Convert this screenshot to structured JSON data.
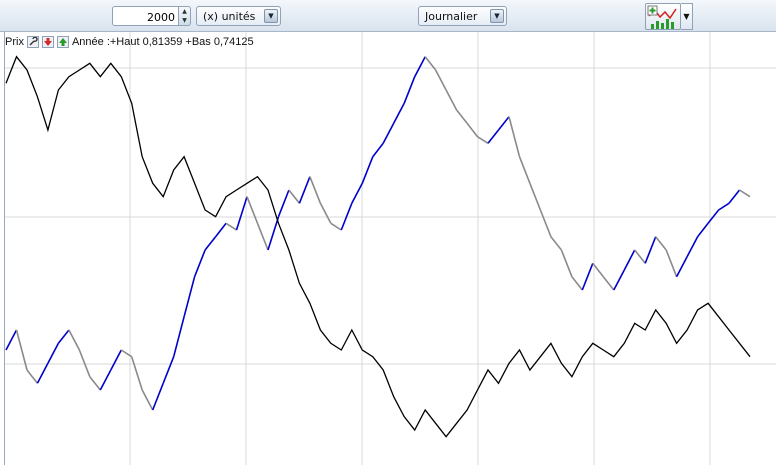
{
  "toolbar": {
    "count_value": "2000",
    "units_label": "(x) unités",
    "period_label": "Journalier",
    "spin_up_glyph": "▲",
    "spin_down_glyph": "▼",
    "select_arrow_glyph": "▼",
    "study_menu_glyph": "▼"
  },
  "legend": {
    "series_label": "Prix",
    "range_text": "Année :+Haut 0,81359 +Bas 0,74125",
    "icons": [
      "wrench-icon",
      "remove-red-icon",
      "up-green-icon"
    ]
  },
  "colors": {
    "series_blue": "#0000cc",
    "series_gray": "#8a8a8a",
    "series_black": "#000000",
    "grid": "#d9d9d9"
  },
  "chart_data": {
    "type": "line",
    "series": [
      {
        "values": [
          0.55,
          0.58,
          0.52,
          0.5,
          0.53,
          0.56,
          0.58,
          0.55,
          0.51,
          0.49,
          0.52,
          0.55,
          0.54,
          0.49,
          0.46,
          0.5,
          0.54,
          0.6,
          0.66,
          0.7,
          0.72,
          0.74,
          0.73,
          0.78,
          0.74,
          0.7,
          0.75,
          0.79,
          0.77,
          0.81,
          0.77,
          0.74,
          0.73,
          0.77,
          0.8,
          0.84,
          0.86,
          0.89,
          0.92,
          0.96,
          0.99,
          0.97,
          0.94,
          0.91,
          0.89,
          0.87,
          0.86,
          0.88,
          0.9,
          0.84,
          0.8,
          0.76,
          0.72,
          0.7,
          0.66,
          0.64,
          0.68,
          0.66,
          0.64,
          0.67,
          0.7,
          0.68,
          0.72,
          0.7,
          0.66,
          0.69,
          0.72,
          0.74,
          0.76,
          0.77,
          0.79,
          0.78
        ]
      },
      {
        "values": [
          0.95,
          0.99,
          0.97,
          0.93,
          0.88,
          0.94,
          0.96,
          0.97,
          0.98,
          0.96,
          0.98,
          0.96,
          0.92,
          0.84,
          0.8,
          0.78,
          0.82,
          0.84,
          0.8,
          0.76,
          0.75,
          0.78,
          0.79,
          0.8,
          0.81,
          0.79,
          0.74,
          0.7,
          0.65,
          0.62,
          0.58,
          0.56,
          0.55,
          0.58,
          0.55,
          0.54,
          0.52,
          0.48,
          0.45,
          0.43,
          0.46,
          0.44,
          0.42,
          0.44,
          0.46,
          0.49,
          0.52,
          0.5,
          0.53,
          0.55,
          0.52,
          0.54,
          0.56,
          0.53,
          0.51,
          0.54,
          0.56,
          0.55,
          0.54,
          0.56,
          0.59,
          0.58,
          0.61,
          0.59,
          0.56,
          0.58,
          0.61,
          0.62,
          0.6,
          0.58,
          0.56,
          0.54
        ]
      }
    ]
  }
}
